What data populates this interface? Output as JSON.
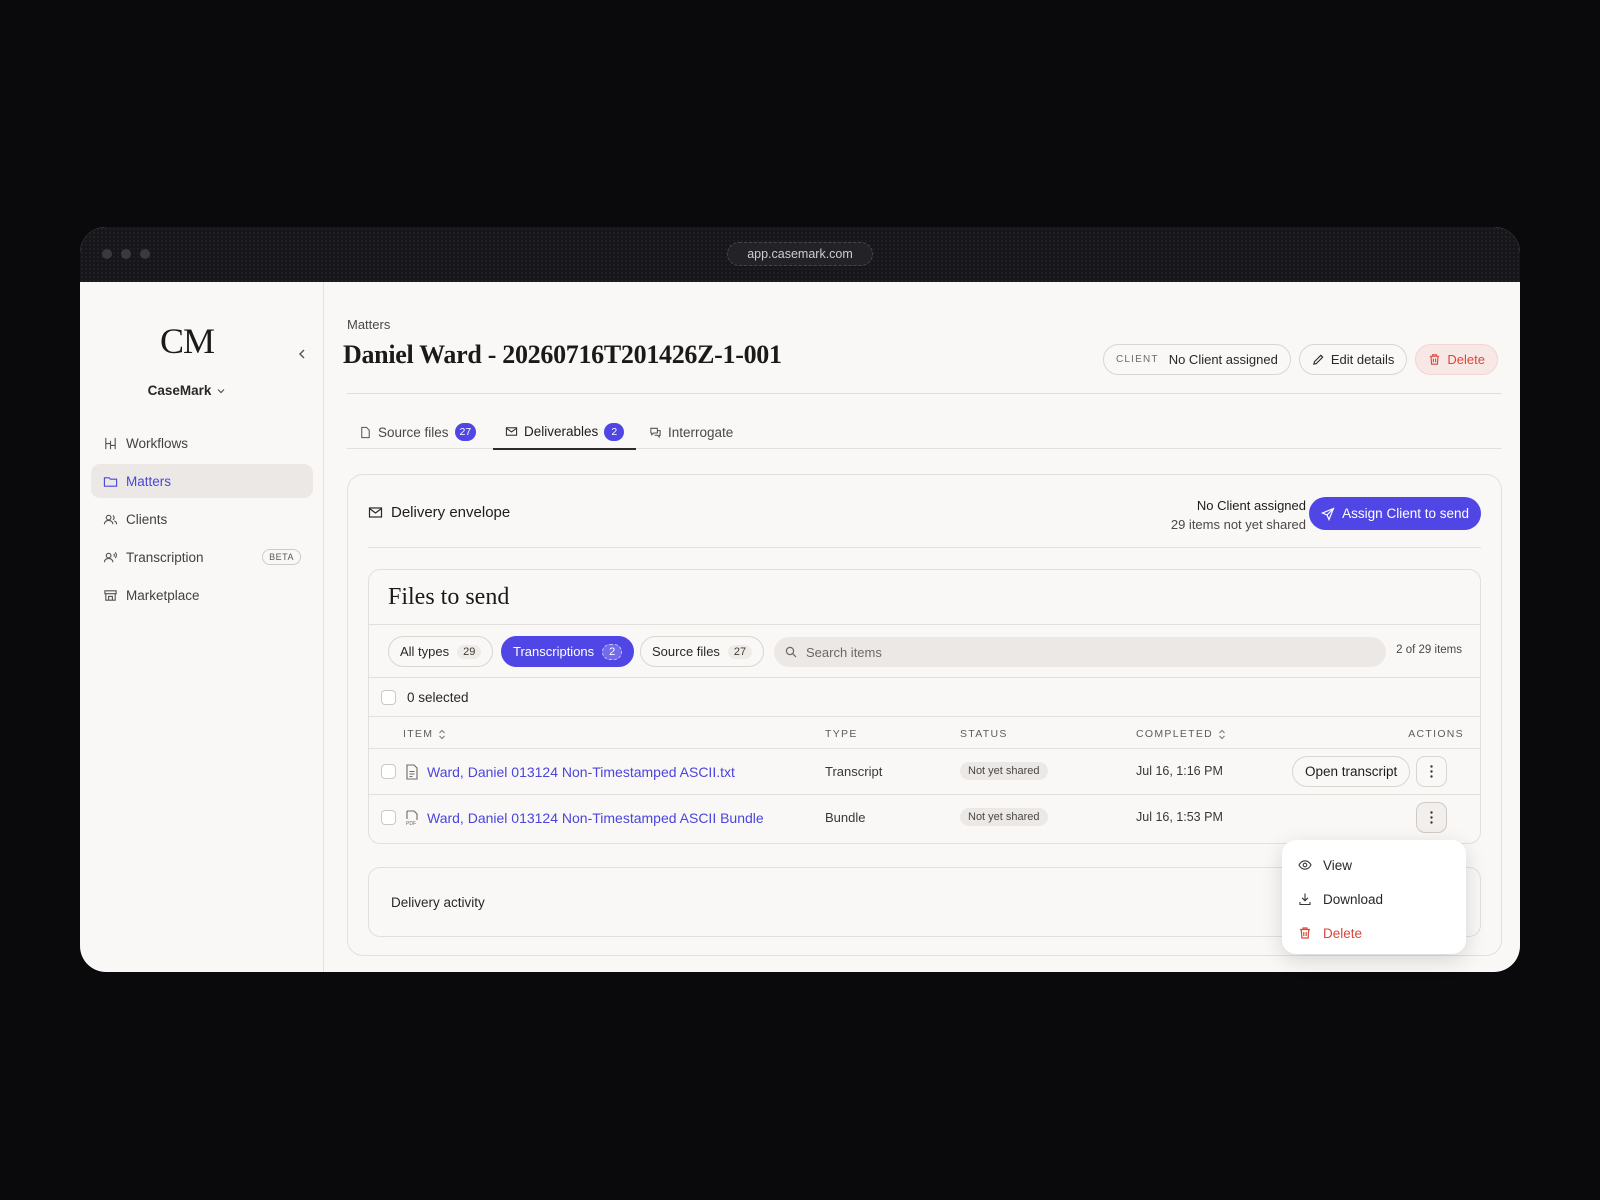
{
  "browser": {
    "url": "app.casemark.com"
  },
  "sidebar": {
    "logo": "CM",
    "workspace": "CaseMark",
    "items": [
      {
        "label": "Workflows",
        "icon": "workflow-icon"
      },
      {
        "label": "Matters",
        "icon": "folder-icon",
        "active": true
      },
      {
        "label": "Clients",
        "icon": "users-icon"
      },
      {
        "label": "Transcription",
        "icon": "transcription-icon",
        "badge": "BETA"
      },
      {
        "label": "Marketplace",
        "icon": "store-icon"
      }
    ]
  },
  "header": {
    "breadcrumb": "Matters",
    "title": "Daniel Ward - 20260716T201426Z-1-001",
    "client_label": "CLIENT",
    "client_value": "No Client assigned",
    "edit_label": "Edit details",
    "delete_label": "Delete"
  },
  "tabs": [
    {
      "label": "Source files",
      "count": "27"
    },
    {
      "label": "Deliverables",
      "count": "2",
      "active": true
    },
    {
      "label": "Interrogate"
    }
  ],
  "envelope": {
    "title": "Delivery envelope",
    "client_status": "No Client assigned",
    "share_status": "29 items not yet shared",
    "assign_label": "Assign Client to send"
  },
  "files": {
    "title": "Files to send",
    "filters": [
      {
        "label": "All types",
        "count": "29"
      },
      {
        "label": "Transcriptions",
        "count": "2",
        "active": true
      },
      {
        "label": "Source files",
        "count": "27"
      }
    ],
    "search_placeholder": "Search items",
    "count_text": "2 of 29 items",
    "selected_text": "0 selected",
    "columns": {
      "item": "ITEM",
      "type": "TYPE",
      "status": "STATUS",
      "completed": "COMPLETED",
      "actions": "ACTIONS"
    },
    "rows": [
      {
        "name": "Ward, Daniel 013124 Non-Timestamped ASCII.txt",
        "type": "Transcript",
        "status": "Not yet shared",
        "completed": "Jul 16, 1:16 PM",
        "action": "Open transcript",
        "icon": "text-file-icon"
      },
      {
        "name": "Ward, Daniel 013124 Non-Timestamped ASCII Bundle",
        "type": "Bundle",
        "status": "Not yet shared",
        "completed": "Jul 16, 1:53 PM",
        "icon": "pdf-file-icon"
      }
    ]
  },
  "activity": {
    "title": "Delivery activity"
  },
  "context_menu": [
    {
      "label": "View",
      "icon": "eye-icon"
    },
    {
      "label": "Download",
      "icon": "download-icon"
    },
    {
      "label": "Delete",
      "icon": "trash-icon",
      "danger": true
    }
  ],
  "colors": {
    "accent": "#4f46e5",
    "danger": "#d9473a",
    "background": "#faf8f6"
  }
}
